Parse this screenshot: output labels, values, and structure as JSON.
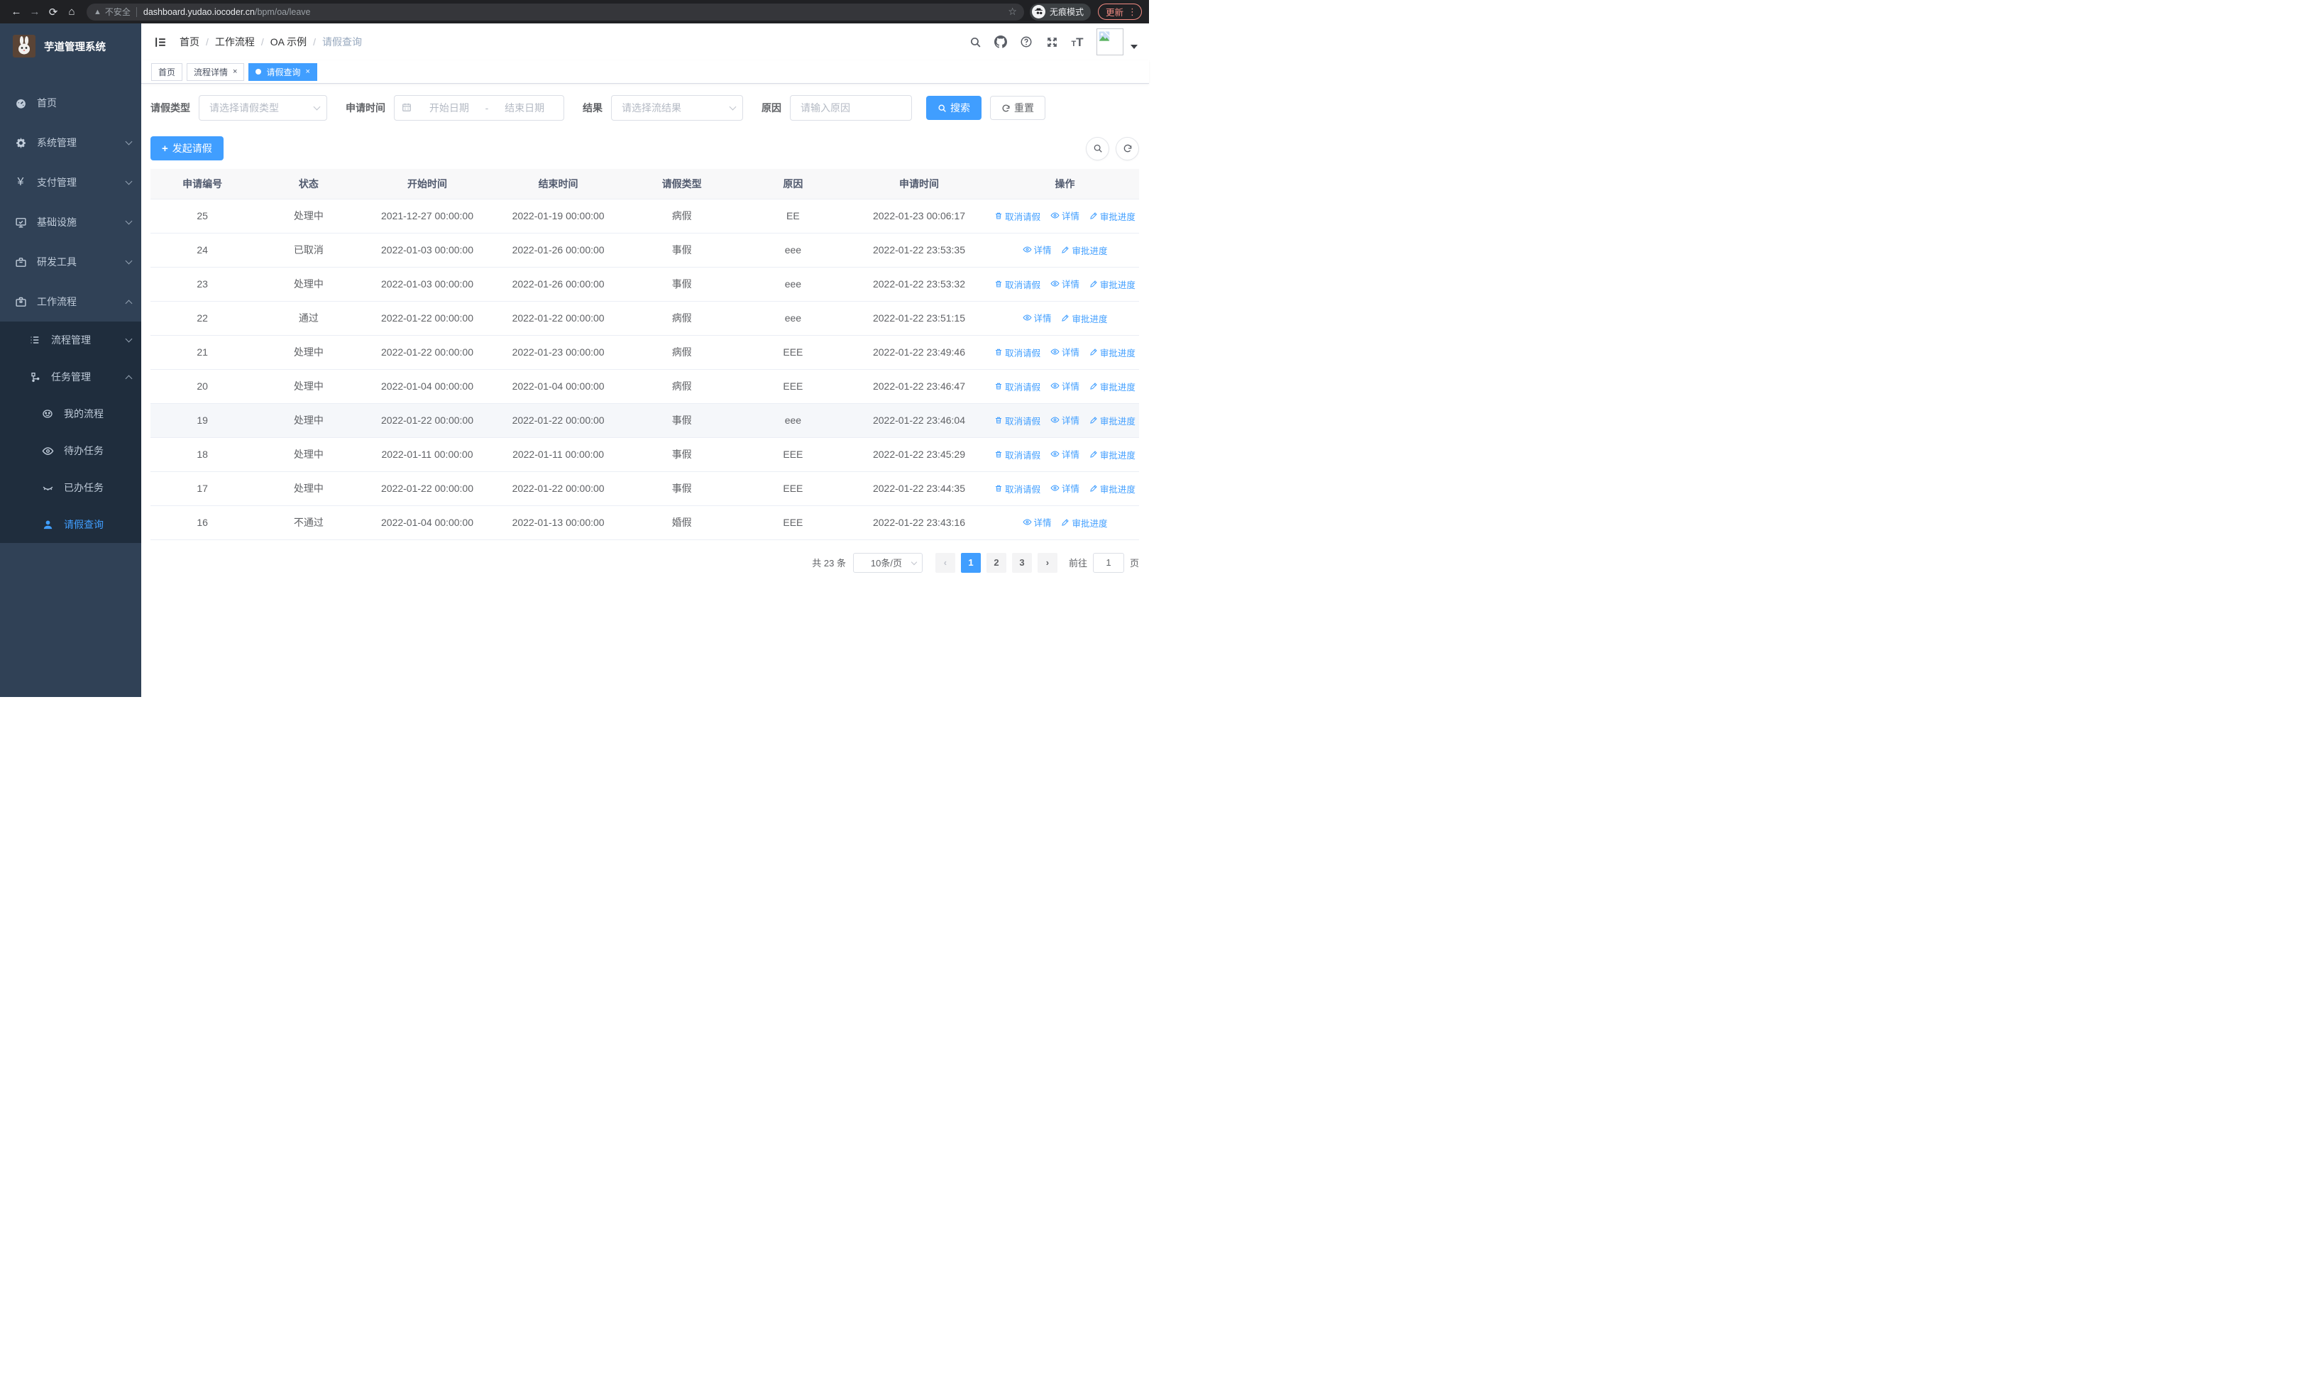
{
  "browser": {
    "security_warning": "不安全",
    "url_host": "dashboard.yudao.iocoder.cn",
    "url_path": "/bpm/oa/leave",
    "incognito_label": "无痕模式",
    "update_label": "更新"
  },
  "sidebar": {
    "app_title": "芋道管理系统",
    "items": [
      {
        "label": "首页",
        "icon": "gauge-icon"
      },
      {
        "label": "系统管理",
        "icon": "gear-icon",
        "chevron": "down"
      },
      {
        "label": "支付管理",
        "icon": "yen-icon",
        "chevron": "down"
      },
      {
        "label": "基础设施",
        "icon": "monitor-icon",
        "chevron": "down"
      },
      {
        "label": "研发工具",
        "icon": "toolbox-icon",
        "chevron": "down"
      },
      {
        "label": "工作流程",
        "icon": "briefcase-icon",
        "chevron": "up"
      }
    ],
    "submenu": {
      "items": [
        {
          "label": "流程管理",
          "icon": "list-icon",
          "chevron": "down"
        },
        {
          "label": "任务管理",
          "icon": "workflow-icon",
          "chevron": "up"
        },
        {
          "label": "我的流程",
          "icon": "face-icon"
        },
        {
          "label": "待办任务",
          "icon": "eye-icon"
        },
        {
          "label": "已办任务",
          "icon": "eye-closed-icon"
        },
        {
          "label": "请假查询",
          "icon": "user-icon",
          "active": true
        }
      ]
    }
  },
  "breadcrumb": {
    "items": [
      "首页",
      "工作流程",
      "OA 示例",
      "请假查询"
    ]
  },
  "tabs_bar": {
    "tabs": [
      {
        "label": "首页",
        "closable": false,
        "active": false
      },
      {
        "label": "流程详情",
        "closable": true,
        "active": false
      },
      {
        "label": "请假查询",
        "closable": true,
        "active": true
      }
    ]
  },
  "filters": {
    "leave_type_label": "请假类型",
    "leave_type_placeholder": "请选择请假类型",
    "apply_time_label": "申请时间",
    "start_date_placeholder": "开始日期",
    "range_separator": "-",
    "end_date_placeholder": "结束日期",
    "result_label": "结果",
    "result_placeholder": "请选择流结果",
    "reason_label": "原因",
    "reason_placeholder": "请输入原因",
    "search_label": "搜索",
    "reset_label": "重置"
  },
  "toolbar": {
    "create_label": "发起请假"
  },
  "table": {
    "columns": [
      "申请编号",
      "状态",
      "开始时间",
      "结束时间",
      "请假类型",
      "原因",
      "申请时间",
      "操作"
    ],
    "action_labels": {
      "cancel": "取消请假",
      "detail": "详情",
      "progress": "审批进度"
    },
    "rows": [
      {
        "id": "25",
        "status": "处理中",
        "start": "2021-12-27 00:00:00",
        "end": "2022-01-19 00:00:00",
        "type": "病假",
        "reason": "EE",
        "apply": "2022-01-23 00:06:17",
        "cancel": true,
        "highlight": false
      },
      {
        "id": "24",
        "status": "已取消",
        "start": "2022-01-03 00:00:00",
        "end": "2022-01-26 00:00:00",
        "type": "事假",
        "reason": "eee",
        "apply": "2022-01-22 23:53:35",
        "cancel": false,
        "highlight": false
      },
      {
        "id": "23",
        "status": "处理中",
        "start": "2022-01-03 00:00:00",
        "end": "2022-01-26 00:00:00",
        "type": "事假",
        "reason": "eee",
        "apply": "2022-01-22 23:53:32",
        "cancel": true,
        "highlight": false
      },
      {
        "id": "22",
        "status": "通过",
        "start": "2022-01-22 00:00:00",
        "end": "2022-01-22 00:00:00",
        "type": "病假",
        "reason": "eee",
        "apply": "2022-01-22 23:51:15",
        "cancel": false,
        "highlight": false
      },
      {
        "id": "21",
        "status": "处理中",
        "start": "2022-01-22 00:00:00",
        "end": "2022-01-23 00:00:00",
        "type": "病假",
        "reason": "EEE",
        "apply": "2022-01-22 23:49:46",
        "cancel": true,
        "highlight": false
      },
      {
        "id": "20",
        "status": "处理中",
        "start": "2022-01-04 00:00:00",
        "end": "2022-01-04 00:00:00",
        "type": "病假",
        "reason": "EEE",
        "apply": "2022-01-22 23:46:47",
        "cancel": true,
        "highlight": false
      },
      {
        "id": "19",
        "status": "处理中",
        "start": "2022-01-22 00:00:00",
        "end": "2022-01-22 00:00:00",
        "type": "事假",
        "reason": "eee",
        "apply": "2022-01-22 23:46:04",
        "cancel": true,
        "highlight": true
      },
      {
        "id": "18",
        "status": "处理中",
        "start": "2022-01-11 00:00:00",
        "end": "2022-01-11 00:00:00",
        "type": "事假",
        "reason": "EEE",
        "apply": "2022-01-22 23:45:29",
        "cancel": true,
        "highlight": false
      },
      {
        "id": "17",
        "status": "处理中",
        "start": "2022-01-22 00:00:00",
        "end": "2022-01-22 00:00:00",
        "type": "事假",
        "reason": "EEE",
        "apply": "2022-01-22 23:44:35",
        "cancel": true,
        "highlight": false
      },
      {
        "id": "16",
        "status": "不通过",
        "start": "2022-01-04 00:00:00",
        "end": "2022-01-13 00:00:00",
        "type": "婚假",
        "reason": "EEE",
        "apply": "2022-01-22 23:43:16",
        "cancel": false,
        "highlight": false
      }
    ]
  },
  "pagination": {
    "total_text": "共 23 条",
    "page_size": "10条/页",
    "pages": [
      "1",
      "2",
      "3"
    ],
    "active_page": "1",
    "goto_label": "前往",
    "goto_value": "1",
    "page_suffix": "页"
  },
  "colors": {
    "accent": "#409eff",
    "sidebar_bg": "#304156",
    "submenu_bg": "#1f2d3d",
    "sidebar_text": "#bfcbd9",
    "chrome_bg": "#202124",
    "update_accent": "#f28b82",
    "table_header_bg": "#f8f8f9",
    "row_highlight_bg": "#f5f7fa"
  }
}
